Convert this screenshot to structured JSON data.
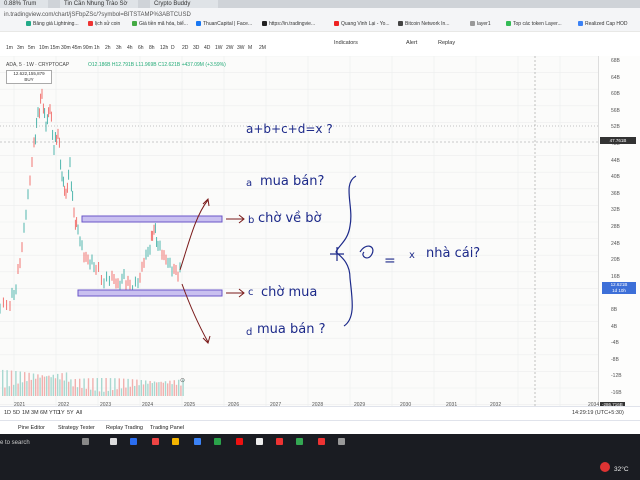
{
  "browser": {
    "tabs": [
      "0.88% Trum",
      "Tin Cần Nhung Trào Sờ",
      "Crypto Buddy"
    ],
    "url": "in.tradingview.com/chart/jSFbpZSc/?symbol=BITSTAMP%3ABTCUSD",
    "bookmarks": [
      "Bảng giá Lightning...",
      "lịch sử coin",
      "Giá tiền mã hóa, biể...",
      "ThuanCapital | Face...",
      "https://in.tradingvie...",
      "Quang Vinh Lại - Yo...",
      "Bitcoin Network In...",
      "layer1",
      "Top các token Layer...",
      "Realized Cap HOD"
    ]
  },
  "toolbar": {
    "timeframes": [
      "1m",
      "3m",
      "5m",
      "10m",
      "15m",
      "30m",
      "45m",
      "90m",
      "1h",
      "2h",
      "3h",
      "4h",
      "6h",
      "8h",
      "12h",
      "D",
      "2D",
      "3D",
      "4D",
      "1W",
      "2W",
      "3W",
      "M",
      "2M"
    ],
    "indicators_label": "Indicators",
    "alert_label": "Alert",
    "replay_label": "Replay"
  },
  "chart": {
    "symbol": "ADA, 5 · 1W · CRYPTOCAP",
    "ohlc": "O12.186B H12.791B L11.969B C12.621B +437.09M (+3.59%)",
    "price_box": [
      "12.622,155,879",
      "BUY"
    ],
    "y_labels": [
      "68B",
      "64B",
      "60B",
      "56B",
      "52B",
      "48B",
      "44B",
      "40B",
      "36B",
      "32B",
      "28B",
      "24B",
      "20B",
      "16B",
      "12B",
      "8B",
      "4B",
      "-4B",
      "-8B",
      "-12B",
      "-16B"
    ],
    "current_tag": [
      "12.621B",
      "1d 10h"
    ],
    "crosshair_tag": "47.761B",
    "x_labels": [
      "2021",
      "2022",
      "2023",
      "2024",
      "2025",
      "2026",
      "2027",
      "2028",
      "2029",
      "2030",
      "2031",
      "2032",
      "2034"
    ],
    "date_tag": "Mon 06 Sep '32",
    "bottom_price": "-286.716B"
  },
  "notes": {
    "equation": "a+b+c+d=x  ?",
    "a_letter": "a",
    "a_text": "mua bán?",
    "b_letter": "b",
    "b_text": "chờ về bờ",
    "c_letter": "c",
    "c_text": "chờ mua",
    "d_letter": "d",
    "d_text": "mua bán ?",
    "eq_sign": "=",
    "x_letter": "x",
    "x_text": "nhà cái?"
  },
  "ranges": [
    "1D",
    "5D",
    "1M",
    "3M",
    "6M",
    "YTD",
    "1Y",
    "5Y",
    "All"
  ],
  "panels": [
    "Pine Editor",
    "Strategy Tester",
    "Replay Trading",
    "Trading Panel"
  ],
  "status": {
    "clock": "14:29:19 (UTC+5:30)"
  },
  "taskbar": {
    "search": "e to search",
    "temperature": "32°C"
  }
}
